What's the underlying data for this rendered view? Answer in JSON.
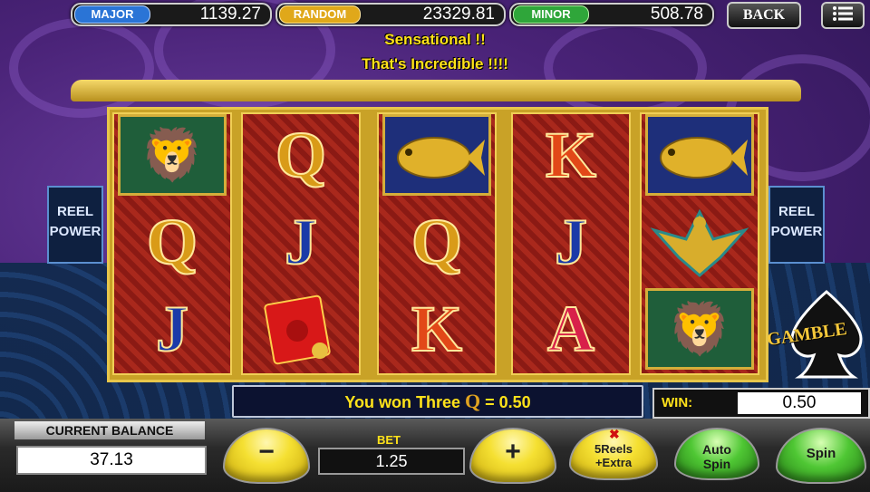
{
  "jackpots": [
    {
      "label": "MAJOR",
      "value": "1139.27",
      "color": "#2a74d6"
    },
    {
      "label": "RANDOM",
      "value": "23329.81",
      "color": "#e0a81a"
    },
    {
      "label": "MINOR",
      "value": "508.78",
      "color": "#2fa63a"
    }
  ],
  "header": {
    "back_label": "BACK",
    "menu_icon": "menu-icon"
  },
  "messages": {
    "line1": "Sensational !!",
    "line2": "That's Incredible !!!!"
  },
  "side_logo": {
    "line1": "REEL",
    "line2": "POWER"
  },
  "reels": [
    [
      {
        "sym": "lion"
      },
      {
        "sym": "Q"
      },
      {
        "sym": "J"
      }
    ],
    [
      {
        "sym": "Q"
      },
      {
        "sym": "J"
      },
      {
        "sym": "envelope"
      }
    ],
    [
      {
        "sym": "fish"
      },
      {
        "sym": "Q"
      },
      {
        "sym": "K"
      }
    ],
    [
      {
        "sym": "K"
      },
      {
        "sym": "J"
      },
      {
        "sym": "A"
      }
    ],
    [
      {
        "sym": "fish"
      },
      {
        "sym": "phoenix"
      },
      {
        "sym": "lion"
      }
    ]
  ],
  "gamble_label": "GAMBLE",
  "win_message": {
    "prefix": "You won Three",
    "symbol": "Q",
    "suffix": "= 0.50"
  },
  "win": {
    "label": "WIN:",
    "value": "0.50"
  },
  "balance": {
    "label": "CURRENT BALANCE",
    "value": "37.13"
  },
  "bet": {
    "label": "BET",
    "value": "1.25",
    "minus": "−",
    "plus": "+"
  },
  "buttons": {
    "extra_line1": "5Reels",
    "extra_line2": "+Extra",
    "auto_line1": "Auto",
    "auto_line2": "Spin",
    "spin": "Spin"
  }
}
